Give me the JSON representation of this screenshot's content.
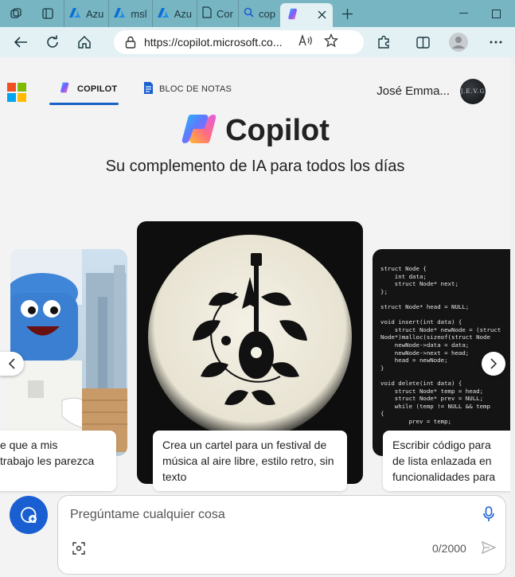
{
  "browser": {
    "tabs": [
      {
        "label": "Azu",
        "icon": "azure-icon"
      },
      {
        "label": "msl",
        "icon": "azure-icon"
      },
      {
        "label": "Azu",
        "icon": "azure-icon"
      },
      {
        "label": "Cor",
        "icon": "document-icon"
      },
      {
        "label": "cop",
        "icon": "search-icon"
      },
      {
        "label": "",
        "icon": "copilot-icon",
        "active": true
      }
    ],
    "url": "https://copilot.microsoft.co...",
    "colors": {
      "tabbar": "#78b5c2",
      "toolbar": "#e4f1f4"
    }
  },
  "header": {
    "tabs": [
      {
        "label": "COPILOT",
        "active": true
      },
      {
        "label": "BLOC DE NOTAS",
        "active": false
      }
    ],
    "user_name": "José Emma...",
    "avatar_text": "J.E.V.G"
  },
  "hero": {
    "title": "Copilot",
    "tagline": "Su complemento de IA para todos los días"
  },
  "cards": [
    {
      "caption": "e que a mis\ntrabajo les parezca"
    },
    {
      "caption": "Crea un cartel para un festival de\nmúsica al aire libre, estilo retro, sin\ntexto"
    },
    {
      "caption": "Escribir código para\nde lista enlazada en\nfuncionalidades para"
    }
  ],
  "code_snippet": "struct Node {\n    int data;\n    struct Node* next;\n};\n\nstruct Node* head = NULL;\n\nvoid insert(int data) {\n    struct Node* newNode = (struct\nNode*)malloc(sizeof(struct Node\n    newNode->data = data;\n    newNode->next = head;\n    head = newNode;\n}\n\nvoid delete(int data) {\n    struct Node* temp = head;\n    struct Node* prev = NULL;\n    while (temp != NULL && temp\n{\n        prev = temp;",
  "composer": {
    "placeholder": "Pregúntame cualquier cosa",
    "counter": "0/2000"
  },
  "colors": {
    "accent": "#1861c6",
    "chat_button": "#1a5fd1"
  }
}
